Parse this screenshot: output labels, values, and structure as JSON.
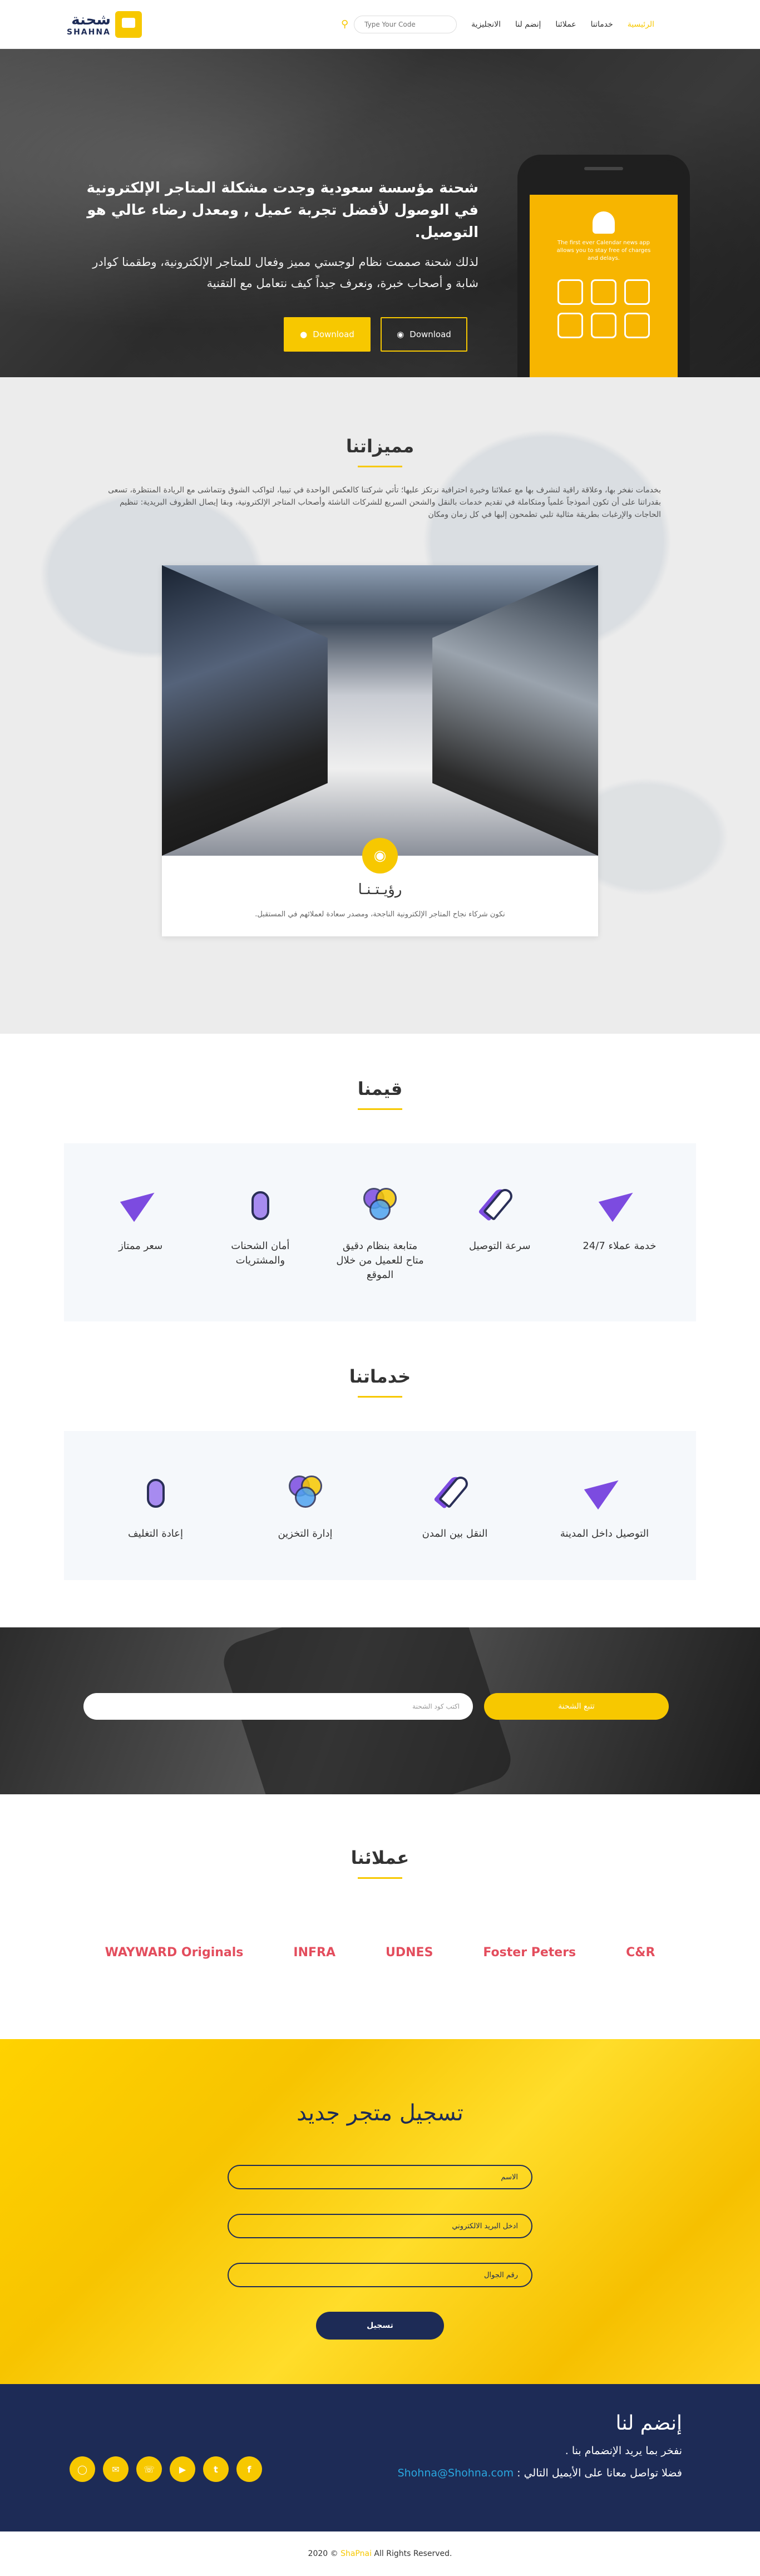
{
  "header": {
    "logo_ar": "شحنة",
    "logo_en": "SHAHNA",
    "search_placeholder": "Type Your Code",
    "nav": [
      "الرئيسية",
      "خدماتنا",
      "عملائنا",
      "إنضم لنا",
      "الانجليزية"
    ]
  },
  "hero": {
    "title": "شحنة مؤسسة سعودية وجدت مشكلة المتاجر الإلكترونية في الوصول لأفضل تجربة عميل , ومعدل رضاء عالي هو التوصيل.",
    "subtitle": "لذلك شحنة صممت نظام لوجستي مميز وفعال للمتاجر الإلكترونية، وطقمنا كوادر شابة و أصحاب خبرة، ونعرف جيداً كيف نتعامل مع التقنية",
    "btn1": "Download",
    "btn2": "Download",
    "phone_text": "The first ever Calendar news app allows you to stay free of charges and delays."
  },
  "features": {
    "title": "مميزاتنا",
    "body": "بخدمات نفخر بها، وعلاقة راقية لنشرف بها مع عملائنا وخبرة احترافية نرتكز عليها؛ تأتي شركتنا كالعكس الواحدة في تيبيا، لتواكب الشوق وتتماشى مع الريادة المنتظرة، تسعى بقدراتنا على أن تكون أنموذجاً علمياً ومتكاملة في تقديم خدمات بالنقل والشحن السريع للشركات الناشئة وأصحاب المتاجر الإلكترونية، وبقا إيصال الظروف البريدية: تنظيم الحاجات والإرغبات بطريقة مثالية تلبي تطمحون إليها في كل زمان ومكان",
    "card_title": "رؤيـتـنـا",
    "card_desc": "نكون شركاء نجاح المتاجر الإلكترونية الناجحة، ومصدر سعادة لعملائهم في المستقبل."
  },
  "values": {
    "title": "قيمنا",
    "items": [
      {
        "label": "خدمة عملاء 24/7",
        "icon": "paper-plane-icon"
      },
      {
        "label": "سرعة التوصيل",
        "icon": "rocket-icon"
      },
      {
        "label": "متابعة بنظام دقيق متاح للعميل من خلال الموقع",
        "icon": "venn-icon"
      },
      {
        "label": "أمان الشحنات والمشتريات",
        "icon": "mouse-icon"
      },
      {
        "label": "سعر ممتاز",
        "icon": "paper-plane-icon"
      }
    ]
  },
  "services": {
    "title": "خدماتنا",
    "items": [
      {
        "label": "التوصيل داخل المدينة",
        "icon": "paper-plane-icon"
      },
      {
        "label": "النقل بين المدن",
        "icon": "rocket-icon"
      },
      {
        "label": "إدارة التخزين",
        "icon": "venn-icon"
      },
      {
        "label": "إعادة التغليف",
        "icon": "mouse-icon"
      }
    ]
  },
  "track": {
    "placeholder": "اكتب كود الشحنة",
    "button": "تتبع الشحنة"
  },
  "clients": {
    "title": "عملائنا",
    "logos": [
      "WAYWARD Originals",
      "INFRA",
      "UDNES",
      "Foster Peters",
      "C&R"
    ]
  },
  "register": {
    "title": "تسجيل متجر جديد",
    "name": "الاسم",
    "email": "ادخل البريد الالكتروني",
    "phone": "رقم الجوال",
    "submit": "تسجيل"
  },
  "join": {
    "title": "إنضم لنا",
    "line1": "نفخر بما يريد الإنضمام بنا .",
    "line2": "فضلا تواصل معانا على الأيميل التالي :",
    "email": "Shohna@Shohna.com",
    "socials": [
      "instagram-icon",
      "mail-icon",
      "whatsapp-icon",
      "youtube-icon",
      "twitter-icon",
      "facebook-icon"
    ]
  },
  "footer": {
    "prefix": "2020 ©",
    "brand": "ShaPnai",
    "suffix": "All Rights Reserved."
  },
  "colors": {
    "accent": "#f7c800",
    "navy": "#1d2b56"
  }
}
